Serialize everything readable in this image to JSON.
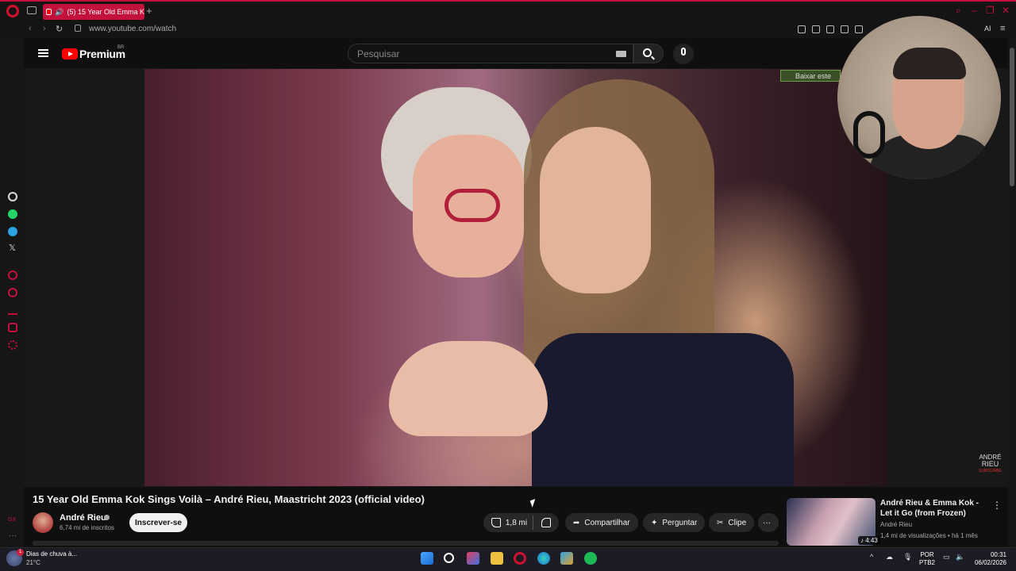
{
  "browser": {
    "tab_title": "(5) 15 Year Old Emma K",
    "url": "www.youtube.com/watch",
    "ai_label": "AI"
  },
  "youtube": {
    "logo_label": "Premium",
    "region": "BR",
    "search_placeholder": "Pesquisar",
    "download_banner": "Baixar este",
    "watermark_line1": "ANDRÉ",
    "watermark_line2": "RIEU",
    "watermark_line3": "SUBSCRIBE"
  },
  "video": {
    "title": "15 Year Old Emma Kok Sings Voilà – André Rieu, Maastricht 2023 (official video)",
    "channel": "André Rieu",
    "subscribers": "6,74 mi de inscritos",
    "subscribe_label": "Inscrever-se",
    "likes": "1,8 mi",
    "share_label": "Compartilhar",
    "ask_label": "Perguntar",
    "clip_label": "Clipe",
    "more_label": "···"
  },
  "recommended": {
    "title": "André Rieu & Emma Kok - Let it Go (from Frozen)",
    "channel": "André Rieu",
    "meta": "1,4 mi de visualizações • há 1 mês",
    "duration": "4:43"
  },
  "taskbar": {
    "weather_text": "Dias de chuva à...",
    "temperature": "21°C",
    "badge": "1",
    "lang_line1": "POR",
    "lang_line2": "PTB2",
    "time": "00:31",
    "date": "06/02/2026"
  },
  "colors": {
    "accent": "#c4113b",
    "youtube_red": "#ff0000",
    "background": "#0f0f0f"
  }
}
